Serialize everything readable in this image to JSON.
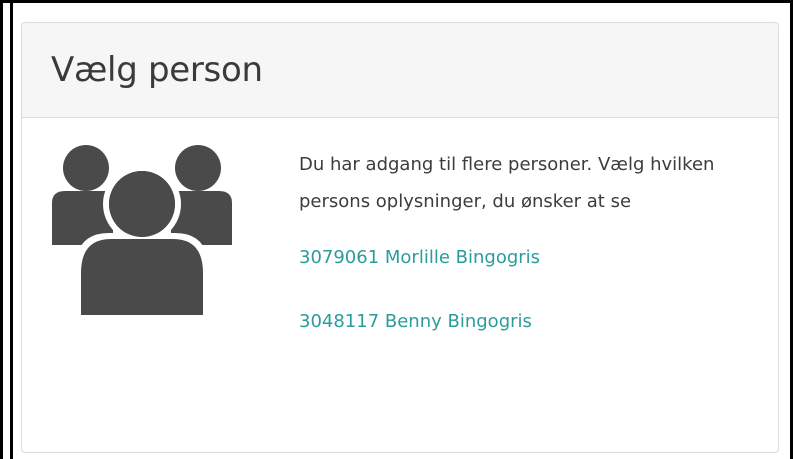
{
  "header": {
    "title": "Vælg person"
  },
  "body": {
    "icon": "group-of-people-icon",
    "intro_text": "Du har adgang til flere personer. Vælg hvilken persons oplysninger, du ønsker at se",
    "persons": [
      {
        "label": "3079061 Morlille Bingogris"
      },
      {
        "label": "3048117 Benny Bingogris"
      }
    ]
  },
  "colors": {
    "link": "#2a9d9a",
    "icon": "#4a4a4a",
    "header_bg": "#f6f6f6",
    "text": "#3c3c3c"
  }
}
